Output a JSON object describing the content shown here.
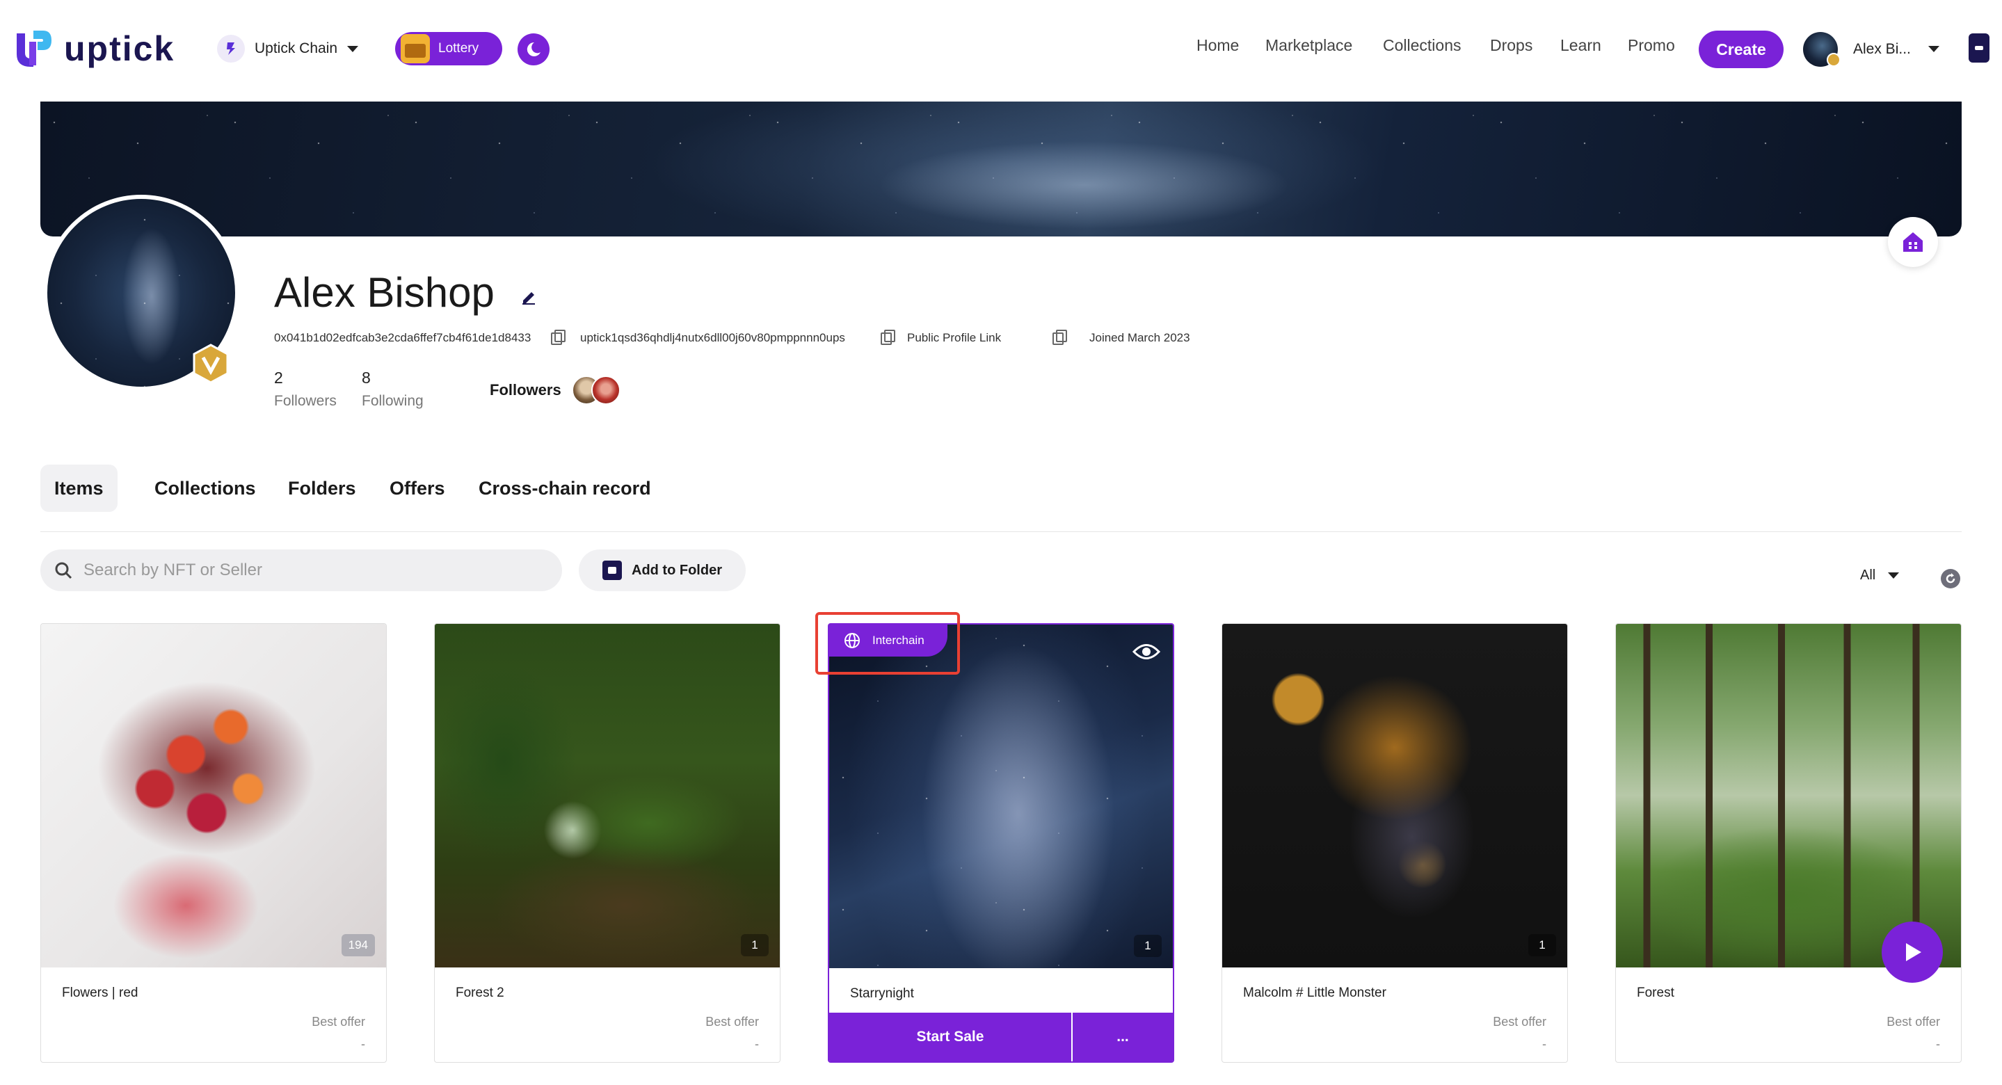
{
  "header": {
    "logo_text": "uptick",
    "chain_label": "Uptick Chain",
    "lottery_label": "Lottery",
    "nav": [
      "Home",
      "Marketplace",
      "Collections",
      "Drops",
      "Learn",
      "Promo"
    ],
    "create_label": "Create",
    "user_name": "Alex Bi..."
  },
  "profile": {
    "name": "Alex Bishop",
    "evm_address": "0x041b1d02edfcab3e2cda6ffef7cb4f61de1d8433",
    "uptick_address": "uptick1qsd36qhdlj4nutx6dll00j60v80pmppnnn0ups",
    "public_link_label": "Public Profile Link",
    "joined": "Joined March 2023",
    "followers_count": "2",
    "followers_label": "Followers",
    "following_count": "8",
    "following_label": "Following",
    "followers_title": "Followers"
  },
  "tabs": [
    "Items",
    "Collections",
    "Folders",
    "Offers",
    "Cross-chain record"
  ],
  "toolbar": {
    "search_placeholder": "Search by NFT or Seller",
    "add_folder_label": "Add to Folder",
    "filter_value": "All"
  },
  "cards": [
    {
      "title": "Flowers | red",
      "count": "194",
      "offer_label": "Best offer",
      "offer_value": "-"
    },
    {
      "title": "Forest 2",
      "count": "1",
      "offer_label": "Best offer",
      "offer_value": "-"
    },
    {
      "title": "Starrynight",
      "count": "1",
      "badge": "Interchain",
      "sale_label": "Start Sale",
      "more_label": "..."
    },
    {
      "title": "Malcolm # Little Monster",
      "count": "1",
      "offer_label": "Best offer",
      "offer_value": "-"
    },
    {
      "title": "Forest",
      "offer_label": "Best offer",
      "offer_value": "-"
    }
  ],
  "colors": {
    "accent": "#7a22d8",
    "brand_dark": "#1b1650",
    "highlight_frame": "#e84033"
  }
}
